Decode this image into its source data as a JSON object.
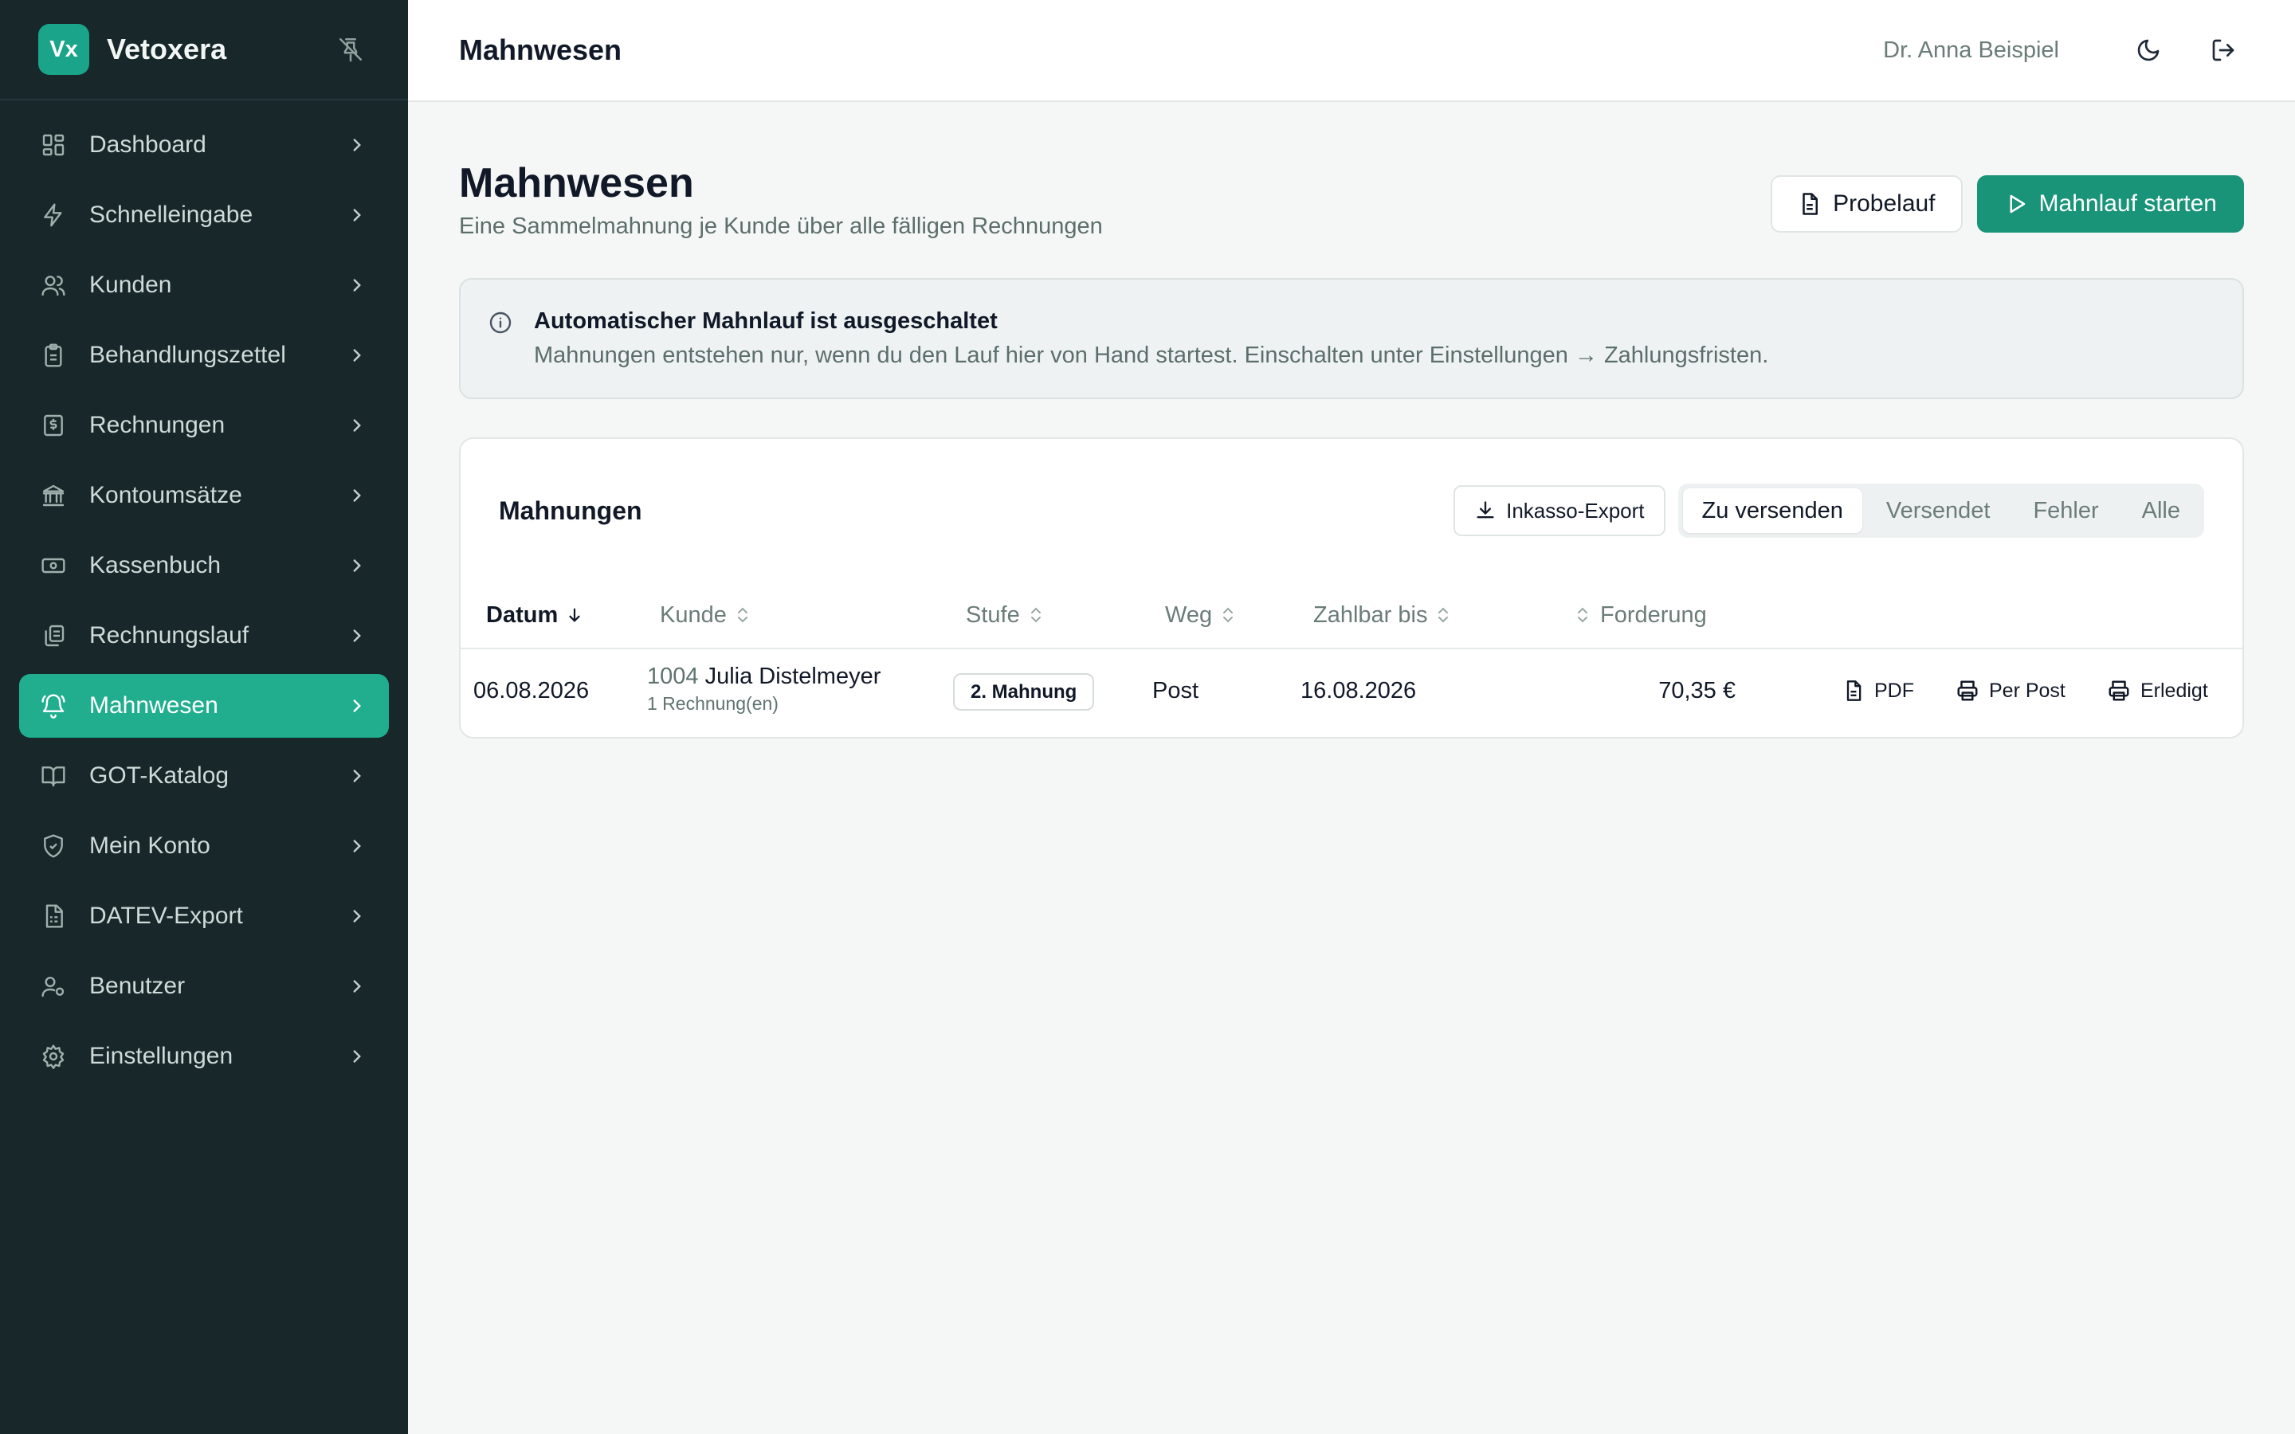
{
  "brand": {
    "logo_text": "Vx",
    "name": "Vetoxera"
  },
  "sidebar": {
    "items": [
      {
        "label": "Dashboard",
        "icon": "dashboard-icon"
      },
      {
        "label": "Schnelleingabe",
        "icon": "lightning-icon"
      },
      {
        "label": "Kunden",
        "icon": "users-icon"
      },
      {
        "label": "Behandlungszettel",
        "icon": "clipboard-icon"
      },
      {
        "label": "Rechnungen",
        "icon": "invoice-icon"
      },
      {
        "label": "Kontoumsätze",
        "icon": "bank-icon"
      },
      {
        "label": "Kassenbuch",
        "icon": "cash-icon"
      },
      {
        "label": "Rechnungslauf",
        "icon": "copy-icon"
      },
      {
        "label": "Mahnwesen",
        "icon": "bell-icon",
        "active": true
      },
      {
        "label": "GOT-Katalog",
        "icon": "book-icon"
      },
      {
        "label": "Mein Konto",
        "icon": "shield-icon"
      },
      {
        "label": "DATEV-Export",
        "icon": "spreadsheet-icon"
      },
      {
        "label": "Benutzer",
        "icon": "user-cog-icon"
      },
      {
        "label": "Einstellungen",
        "icon": "gear-icon"
      }
    ]
  },
  "topbar": {
    "title": "Mahnwesen",
    "user": "Dr. Anna Beispiel"
  },
  "page": {
    "title": "Mahnwesen",
    "subtitle": "Eine Sammelmahnung je Kunde über alle fälligen Rechnungen",
    "probelauf_label": "Probelauf",
    "start_label": "Mahnlauf starten"
  },
  "info": {
    "title": "Automatischer Mahnlauf ist ausgeschaltet",
    "text": "Mahnungen entstehen nur, wenn du den Lauf hier von Hand startest. Einschalten unter Einstellungen → Zahlungsfristen."
  },
  "card": {
    "title": "Mahnungen",
    "export_label": "Inkasso-Export",
    "tabs": [
      "Zu versenden",
      "Versendet",
      "Fehler",
      "Alle"
    ],
    "active_tab": "Zu versenden"
  },
  "table": {
    "columns": [
      "Datum",
      "Kunde",
      "Stufe",
      "Weg",
      "Zahlbar bis",
      "Forderung"
    ],
    "rows": [
      {
        "datum": "06.08.2026",
        "kunden_nr": "1004",
        "kunde": "Julia Distelmeyer",
        "rechnungen": "1 Rechnung(en)",
        "stufe": "2. Mahnung",
        "weg": "Post",
        "zahlbar_bis": "16.08.2026",
        "forderung": "70,35 €",
        "actions": [
          "PDF",
          "Per Post",
          "Erledigt"
        ]
      }
    ]
  },
  "colors": {
    "sidebar_bg": "#17272a",
    "accent": "#20ae8f",
    "primary_button": "#1a9479"
  }
}
